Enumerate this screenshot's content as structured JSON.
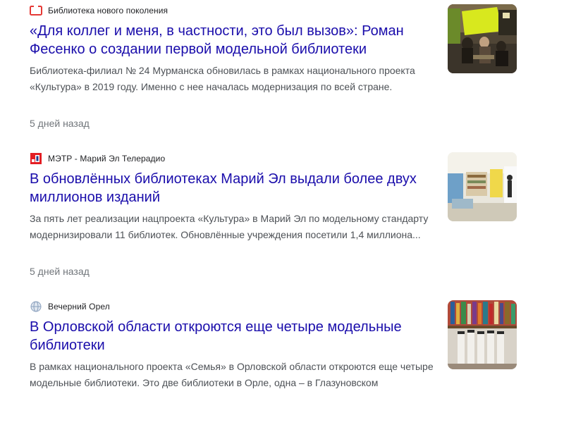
{
  "results": [
    {
      "source": "Библиотека нового поколения",
      "source_icon": "library-logo-icon",
      "title": "«Для коллег и меня, в частности, это был вызов»: Роман Фесенко о создании первой модельной библиотеки",
      "snippet": "Библиотека-филиал № 24 Мурманска обновилась в рамках национального проекта «Культура» в 2019 году. Именно с нее началась модернизация по всей стране.",
      "time": "5 дней назад",
      "thumbnail": "library-reading-room-photo"
    },
    {
      "source": "МЭТР - Марий Эл Телерадио",
      "source_icon": "metr-logo-icon",
      "title": "В обновлённых библиотеках Марий Эл выдали более двух миллионов изданий",
      "snippet": "За пять лет реализации нацпроекта «Культура» в Марий Эл по модельному стандарту модернизировали 11 библиотек. Обновлённые учреждения посетили 1,4 миллиона...",
      "time": "5 дней назад",
      "thumbnail": "modern-library-hall-photo"
    },
    {
      "source": "Вечерний Орел",
      "source_icon": "globe-icon",
      "title": "В Орловской области откроются еще четыре модельные библиотеки",
      "snippet": "В рамках национального проекта «Семья» в Орловской области откроются еще четыре модельные библиотеки. Это две библиотеки в Орле, одна – в Глазуновском",
      "time": "",
      "thumbnail": "books-on-shelf-photo"
    }
  ],
  "colors": {
    "title_link": "#1a0dab",
    "snippet": "#4d5156",
    "meta": "#70757a",
    "library_logo": "#e53935",
    "metr_logo_red": "#e31e24",
    "metr_logo_blue": "#1f3c8c"
  }
}
